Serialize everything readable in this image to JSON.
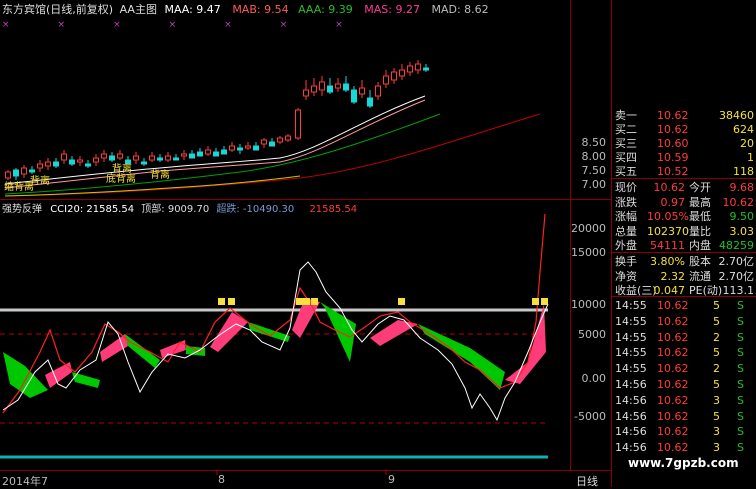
{
  "colors": {
    "up": "#ff3b3b",
    "down": "#17d8d8",
    "green_area": "#00c800",
    "pink_area": "#ff3c7a",
    "white": "#ffffff",
    "yellow": "#f5e13a",
    "gridline": "#b40000",
    "cyan_band": "#12b0b0"
  },
  "header": {
    "title": "东方宾馆(日线,前复权)",
    "indicator": "AA主图",
    "maa": "MAA: 9.47",
    "mab": "MAB: 9.54",
    "aaa": "AAA: 9.39",
    "mas": "MAS: 9.27",
    "mad": "MAD: 8.62"
  },
  "main_chart": {
    "annotations": [
      "缩背离",
      "背离",
      "背离",
      "背离",
      "底背离"
    ],
    "y_ticks": [
      "8.50",
      "8.00",
      "7.50",
      "7.00"
    ]
  },
  "sub_chart": {
    "title": "强势反弹",
    "cci": "CCI20: 21585.54",
    "top": "顶部: 9009.70",
    "oversell": "超跌: -10490.30",
    "value": "21585.54",
    "y_ticks": [
      "20000",
      "15000",
      "10000",
      "5000",
      "0.00",
      "-5000"
    ]
  },
  "x_axis": {
    "labels": [
      "2014年7",
      "8",
      "9"
    ],
    "period": "日线"
  },
  "quote": {
    "asks": [
      {
        "label": "卖一",
        "price": "10.62",
        "vol": "38460"
      },
      {
        "label": "买二",
        "price": "10.62",
        "vol": "624"
      },
      {
        "label": "买三",
        "price": "10.60",
        "vol": "20"
      },
      {
        "label": "买四",
        "price": "10.59",
        "vol": "1"
      },
      {
        "label": "买五",
        "price": "10.52",
        "vol": "118"
      }
    ],
    "stats": [
      {
        "l1": "现价",
        "v1": "10.62",
        "l2": "今开",
        "v2": "9.68"
      },
      {
        "l1": "涨跌",
        "v1": "0.97",
        "l2": "最高",
        "v2": "10.62"
      },
      {
        "l1": "涨幅",
        "v1": "10.05%",
        "l2": "最低",
        "v2": "9.50"
      },
      {
        "l1": "总量",
        "v1": "102370",
        "l2": "量比",
        "v2": "3.03"
      },
      {
        "l1": "外盘",
        "v1": "54111",
        "l2": "内盘",
        "v2": "48259"
      }
    ],
    "stats2": [
      {
        "l1": "换手",
        "v1": "3.80%",
        "l2": "股本",
        "v2": "2.70亿"
      },
      {
        "l1": "净资",
        "v1": "2.32",
        "l2": "流通",
        "v2": "2.70亿"
      },
      {
        "l1": "收益(三)",
        "v1": "0.047",
        "l2": "PE(动)",
        "v2": "113.1"
      }
    ]
  },
  "trades": [
    {
      "time": "14:55",
      "price": "10.62",
      "vol": "5",
      "side": "S"
    },
    {
      "time": "14:55",
      "price": "10.62",
      "vol": "5",
      "side": "S"
    },
    {
      "time": "14:55",
      "price": "10.62",
      "vol": "2",
      "side": "S"
    },
    {
      "time": "14:55",
      "price": "10.62",
      "vol": "5",
      "side": "S"
    },
    {
      "time": "14:55",
      "price": "10.62",
      "vol": "2",
      "side": "S"
    },
    {
      "time": "14:56",
      "price": "10.62",
      "vol": "5",
      "side": "S"
    },
    {
      "time": "14:56",
      "price": "10.62",
      "vol": "3",
      "side": "S"
    },
    {
      "time": "14:56",
      "price": "10.62",
      "vol": "5",
      "side": "S"
    },
    {
      "time": "14:56",
      "price": "10.62",
      "vol": "3",
      "side": "S"
    },
    {
      "time": "14:56",
      "price": "10.62",
      "vol": "3",
      "side": "S"
    }
  ],
  "watermark": "www.7gpzb.com"
}
